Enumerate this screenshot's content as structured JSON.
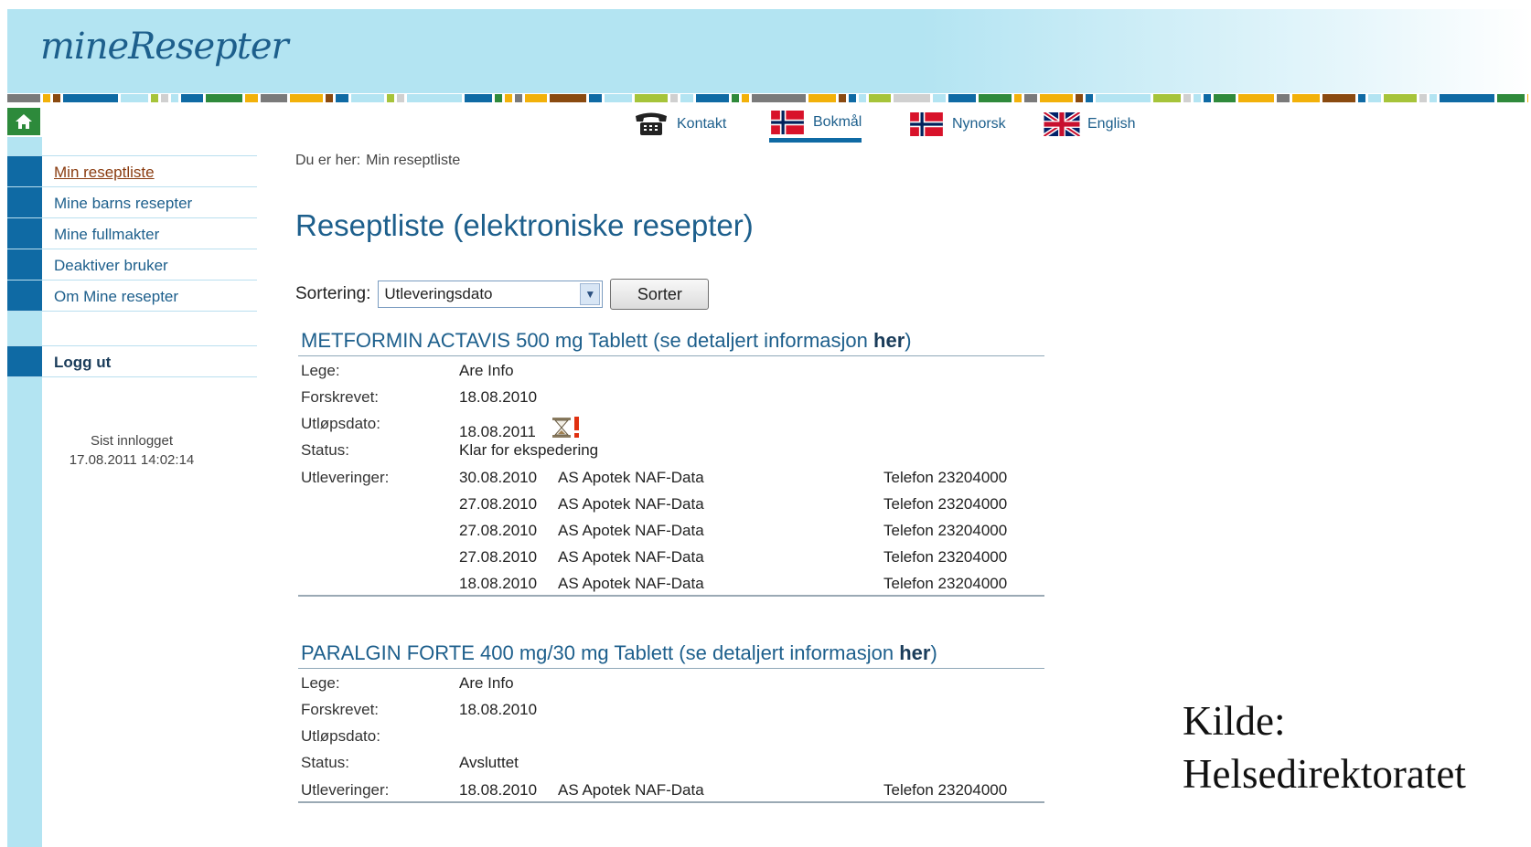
{
  "app": {
    "logo_text": "mineResepter"
  },
  "colors": {
    "header_bg": "#b3e4f2",
    "nav_block": "#0f6aa4",
    "link": "#1d5f8c",
    "home": "#2d8a3b"
  },
  "topnav": [
    {
      "label": "Kontakt",
      "icon": "telephone-icon"
    },
    {
      "label": "Bokmål",
      "icon": "flag-norway-icon",
      "active": true
    },
    {
      "label": "Nynorsk",
      "icon": "flag-norway-icon"
    },
    {
      "label": "English",
      "icon": "flag-uk-icon"
    }
  ],
  "sidebar": {
    "items": [
      {
        "label": "Min reseptliste",
        "active": true
      },
      {
        "label": "Mine barns resepter"
      },
      {
        "label": "Mine fullmakter"
      },
      {
        "label": "Deaktiver bruker"
      },
      {
        "label": "Om Mine resepter"
      }
    ],
    "logout": "Logg ut",
    "last_login_label": "Sist innlogget",
    "last_login_value": "17.08.2011 14:02:14"
  },
  "breadcrumb": {
    "prefix": "Du er her:",
    "current": "Min reseptliste"
  },
  "page_title": "Reseptliste (elektroniske resepter)",
  "sort": {
    "label": "Sortering:",
    "selected": "Utleveringsdato",
    "button": "Sorter"
  },
  "prescriptions": [
    {
      "name": "METFORMIN ACTAVIS 500 mg Tablett",
      "info_prefix": "(se detaljert informasjon ",
      "info_link": "her",
      "info_suffix": ")",
      "fields": [
        {
          "key": "Lege:",
          "value": "Are Info"
        },
        {
          "key": "Forskrevet:",
          "value": "18.08.2010"
        },
        {
          "key": "Utløpsdato:",
          "value": "18.08.2011"
        },
        {
          "key": "Status:",
          "value": "Klar for ekspedering"
        }
      ],
      "deliveries_label": "Utleveringer:",
      "deliveries": [
        {
          "date": "30.08.2010",
          "pharmacy": "AS Apotek NAF-Data",
          "phone": "Telefon 23204000"
        },
        {
          "date": "27.08.2010",
          "pharmacy": "AS Apotek NAF-Data",
          "phone": "Telefon 23204000"
        },
        {
          "date": "27.08.2010",
          "pharmacy": "AS Apotek NAF-Data",
          "phone": "Telefon 23204000"
        },
        {
          "date": "27.08.2010",
          "pharmacy": "AS Apotek NAF-Data",
          "phone": "Telefon 23204000"
        },
        {
          "date": "18.08.2010",
          "pharmacy": "AS Apotek NAF-Data",
          "phone": "Telefon 23204000"
        }
      ]
    },
    {
      "name": "PARALGIN FORTE 400 mg/30 mg Tablett",
      "info_prefix": "(se detaljert informasjon ",
      "info_link": "her",
      "info_suffix": ")",
      "fields": [
        {
          "key": "Lege:",
          "value": "Are Info"
        },
        {
          "key": "Forskrevet:",
          "value": "18.08.2010"
        },
        {
          "key": "Utløpsdato:",
          "value": ""
        },
        {
          "key": "Status:",
          "value": "Avsluttet"
        }
      ],
      "deliveries_label": "Utleveringer:",
      "deliveries": [
        {
          "date": "18.08.2010",
          "pharmacy": "AS Apotek NAF-Data",
          "phone": "Telefon 23204000"
        }
      ]
    }
  ],
  "credit": {
    "line1": "Kilde:",
    "line2": "Helsedirektoratet"
  }
}
